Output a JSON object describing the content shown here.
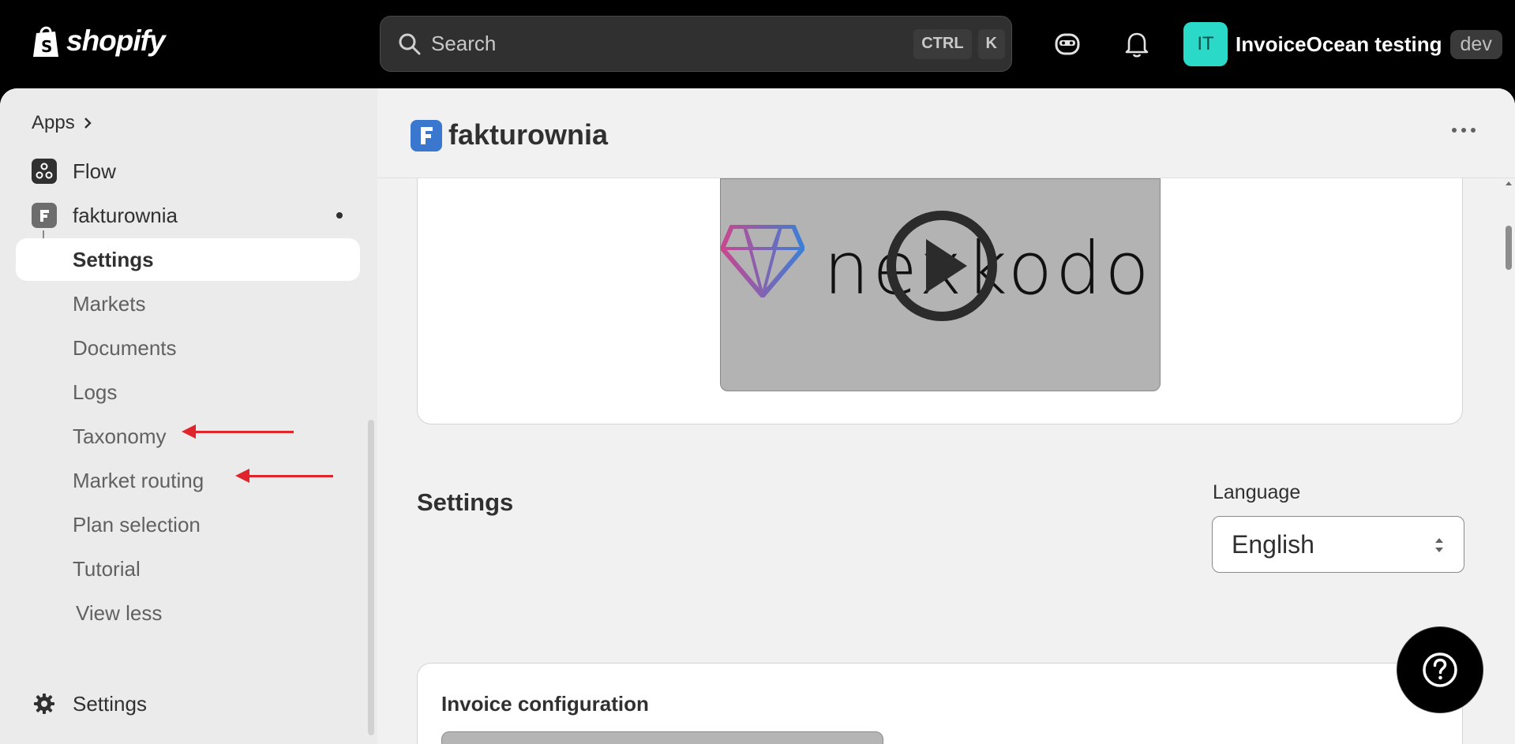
{
  "topbar": {
    "logo_text": "shopify",
    "search": {
      "placeholder": "Search",
      "shortcut_keys": [
        "CTRL",
        "K"
      ]
    },
    "store": {
      "initials": "IT",
      "name": "InvoiceOcean testing",
      "badge": "dev"
    }
  },
  "sidebar": {
    "apps_label": "Apps",
    "items": [
      {
        "label": "Flow",
        "icon": "flow-icon"
      },
      {
        "label": "fakturownia",
        "icon": "fakturownia-app-icon"
      }
    ],
    "subitems": [
      {
        "label": "Settings",
        "active": true
      },
      {
        "label": "Markets"
      },
      {
        "label": "Documents"
      },
      {
        "label": "Logs"
      },
      {
        "label": "Taxonomy"
      },
      {
        "label": "Market routing"
      },
      {
        "label": "Plan selection"
      },
      {
        "label": "Tutorial"
      },
      {
        "label": "View less"
      }
    ],
    "settings_label": "Settings",
    "annotation_color": "#e0242b"
  },
  "content": {
    "app_title": "fakturownia",
    "video": {
      "brand_text": "nexkodo"
    },
    "settings_heading": "Settings",
    "language": {
      "label": "Language",
      "value": "English"
    },
    "invoice_card": {
      "title": "Invoice configuration"
    }
  },
  "colors": {
    "topbar_bg": "#000000",
    "avatar_bg": "#2ad9c8",
    "app_icon_bg": "#3a78d0",
    "arrow": "#e0242b"
  }
}
